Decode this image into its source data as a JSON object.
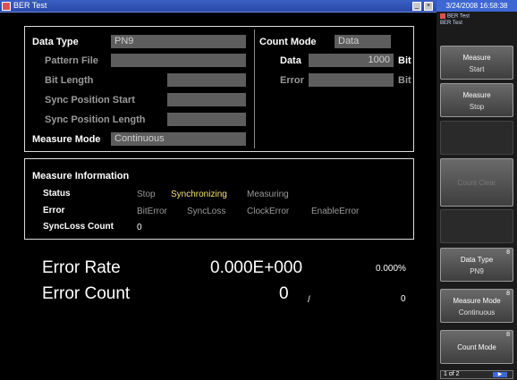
{
  "window": {
    "title": "BER Test",
    "minimize_glyph": "_",
    "close_glyph": "×"
  },
  "settings": {
    "data_type": {
      "label": "Data Type",
      "value": "PN9"
    },
    "pattern_file": {
      "label": "Pattern File",
      "value": ""
    },
    "bit_length": {
      "label": "Bit Length",
      "value": ""
    },
    "sync_position_start": {
      "label": "Sync Position Start",
      "value": ""
    },
    "sync_position_length": {
      "label": "Sync Position Length",
      "value": ""
    },
    "measure_mode": {
      "label": "Measure Mode",
      "value": "Continuous"
    },
    "count_mode": {
      "label": "Count Mode",
      "value": "Data"
    },
    "data": {
      "label": "Data",
      "value": "1000",
      "unit": "Bit"
    },
    "error": {
      "label": "Error",
      "value": "",
      "unit": "Bit"
    }
  },
  "measure_info": {
    "title": "Measure Information",
    "status_label": "Status",
    "status_values": [
      "Stop",
      "Synchronizing",
      "Measuring"
    ],
    "active_status": "Synchronizing",
    "error_label": "Error",
    "error_values": [
      "BitError",
      "SyncLoss",
      "ClockError",
      "EnableError"
    ],
    "syncloss_label": "SyncLoss Count",
    "syncloss_value": "0"
  },
  "results": {
    "error_rate_label": "Error Rate",
    "error_rate_value": "0.000E+000",
    "error_rate_percent": "0.000%",
    "error_count_label": "Error Count",
    "error_count_value": "0",
    "error_count_separator": "/",
    "error_count_total": "0"
  },
  "sidebar": {
    "datetime": "3/24/2008 16:58:38",
    "app_title": "BER Test",
    "app_subtitle": "BER Test",
    "buttons": [
      {
        "line1": "Measure",
        "line2": "Start",
        "index": ""
      },
      {
        "line1": "Measure",
        "line2": "Stop",
        "index": ""
      },
      {
        "line1": "Count Clear",
        "line2": "",
        "index": ""
      },
      {
        "line1": "Data Type",
        "line2": "PN9",
        "index": "8"
      },
      {
        "line1": "Measure Mode",
        "line2": "Continuous",
        "index": "8"
      },
      {
        "line1": "Count Mode",
        "line2": "",
        "index": "8"
      }
    ],
    "page_indicator": "1 of 2",
    "page_arrow": "▶"
  },
  "colors": {
    "accent": "#3f67d4",
    "highlight": "#f5e27a",
    "dim_text": "#9a9a9a",
    "field_bg": "#5d5d5d"
  }
}
